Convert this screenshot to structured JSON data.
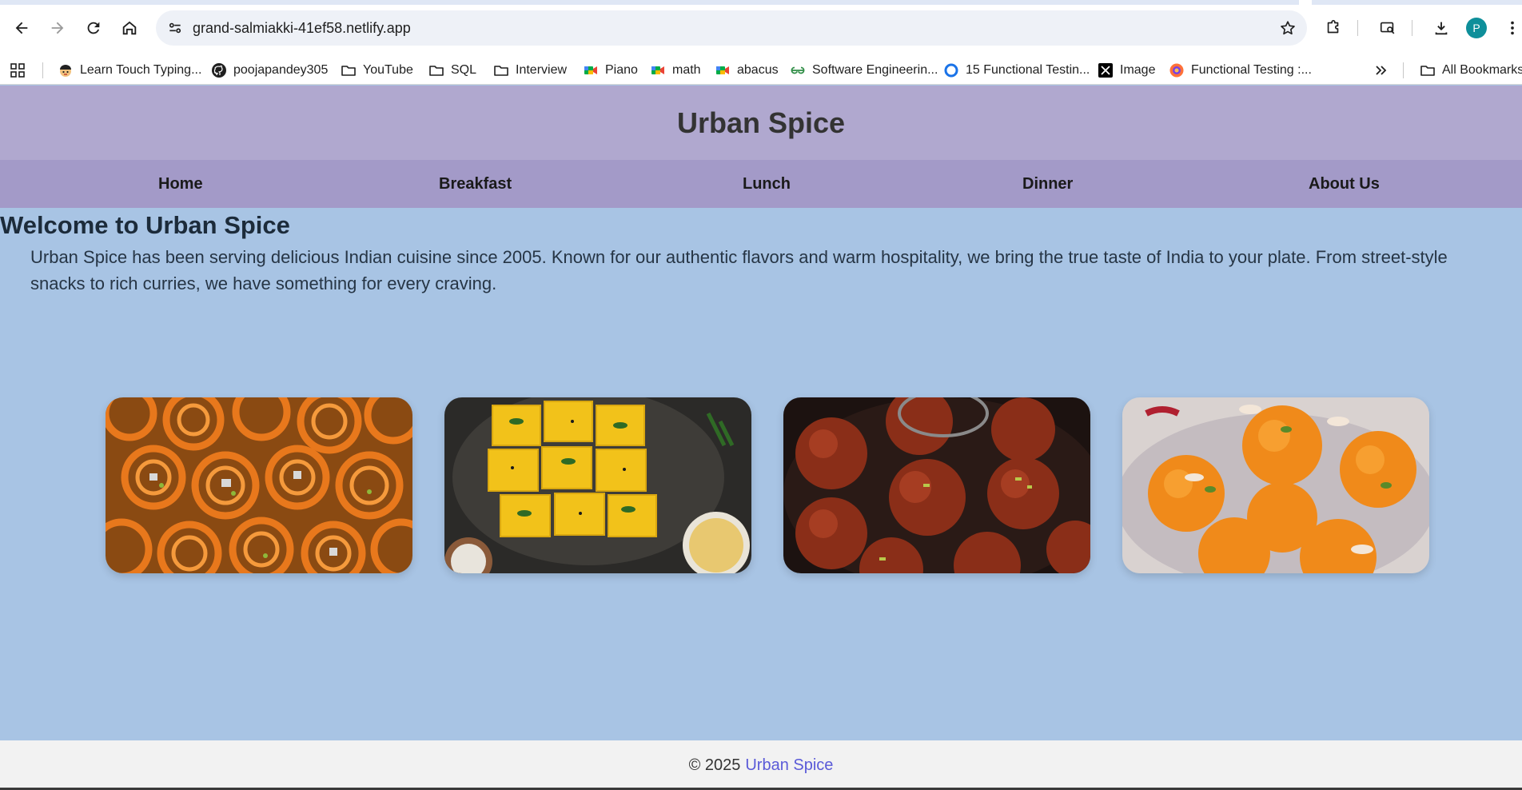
{
  "browser": {
    "url": "grand-salmiakki-41ef58.netlify.app",
    "profile_initial": "P",
    "bookmarks": [
      {
        "label": "Learn Touch Typing...",
        "icon": "typing-mascot-icon"
      },
      {
        "label": "poojapandey305",
        "icon": "github-icon"
      },
      {
        "label": "YouTube",
        "icon": "folder-icon"
      },
      {
        "label": "SQL",
        "icon": "folder-icon"
      },
      {
        "label": "Interview",
        "icon": "folder-icon"
      },
      {
        "label": "Piano",
        "icon": "meet-icon"
      },
      {
        "label": "math",
        "icon": "meet-icon"
      },
      {
        "label": "abacus",
        "icon": "meet-icon"
      },
      {
        "label": "Software Engineerin...",
        "icon": "geeksforgeeks-icon"
      },
      {
        "label": "15 Functional Testin...",
        "icon": "circle-icon"
      },
      {
        "label": "Image",
        "icon": "x-icon"
      },
      {
        "label": "Functional Testing :...",
        "icon": "firefox-icon"
      }
    ],
    "all_bookmarks_label": "All Bookmarks"
  },
  "site": {
    "title": "Urban Spice",
    "nav": [
      "Home",
      "Breakfast",
      "Lunch",
      "Dinner",
      "About Us"
    ],
    "welcome_heading": "Welcome to Urban Spice",
    "intro": "Urban Spice has been serving delicious Indian cuisine since 2005. Known for our authentic flavors and warm hospitality, we bring the true taste of India to your plate. From street-style snacks to rich curries, we have something for every craving.",
    "gallery": [
      "jalebi-image",
      "dhokla-image",
      "gulab-jamun-image",
      "ladoo-image"
    ],
    "footer": {
      "copyright": "© 2025",
      "brand": "Urban Spice"
    }
  },
  "colors": {
    "header_bg": "#b0a8cf",
    "nav_bg": "#a39ac8",
    "page_bg": "#a8c4e4",
    "footer_brand": "#5a5ad8"
  }
}
